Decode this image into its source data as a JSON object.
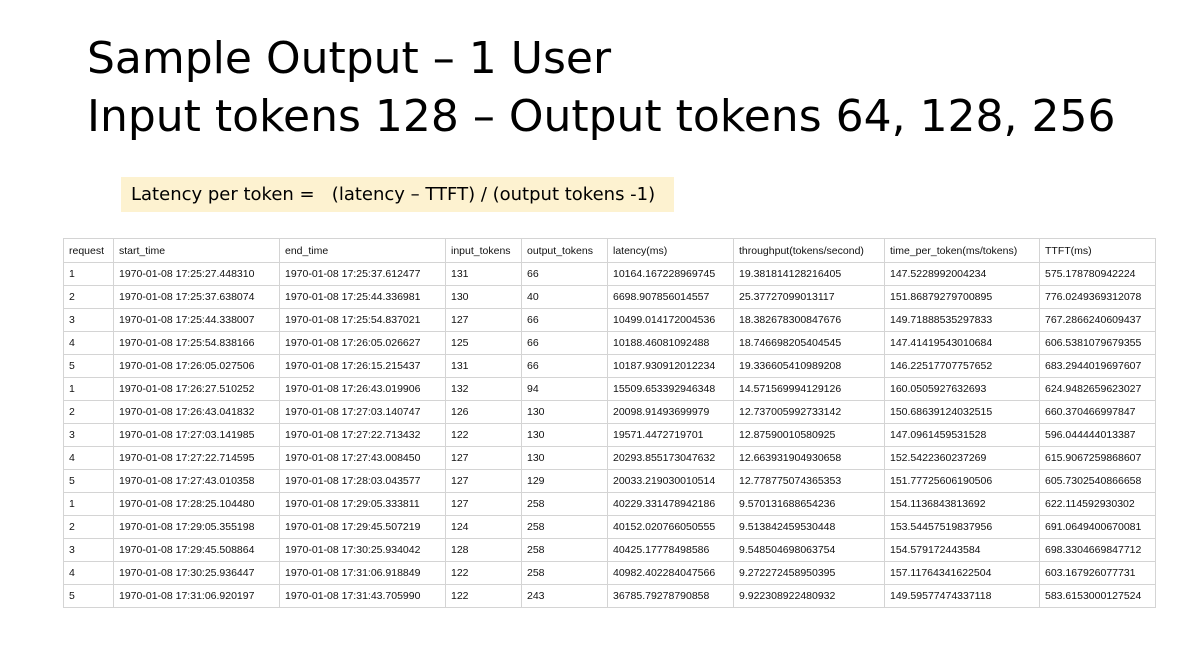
{
  "slide": {
    "title_line1": "Sample Output – 1 User",
    "title_line2": "Input tokens 128 – Output tokens 64, 128, 256",
    "formula": "Latency per token =   (latency – TTFT) / (output tokens -1)",
    "formula_bg": "#fdf2d0"
  },
  "table": {
    "headers": [
      "request",
      "start_time",
      "end_time",
      "input_tokens",
      "output_tokens",
      "latency(ms)",
      "throughput(tokens/second)",
      "time_per_token(ms/tokens)",
      "TTFT(ms)"
    ],
    "rows": [
      [
        "1",
        "1970-01-08 17:25:27.448310",
        "1970-01-08 17:25:37.612477",
        "131",
        "66",
        "10164.167228969745",
        "19.381814128216405",
        "147.5228992004234",
        "575.178780942224"
      ],
      [
        "2",
        "1970-01-08 17:25:37.638074",
        "1970-01-08 17:25:44.336981",
        "130",
        "40",
        "6698.907856014557",
        "25.37727099013117",
        "151.86879279700895",
        "776.0249369312078"
      ],
      [
        "3",
        "1970-01-08 17:25:44.338007",
        "1970-01-08 17:25:54.837021",
        "127",
        "66",
        "10499.014172004536",
        "18.382678300847676",
        "149.71888535297833",
        "767.2866240609437"
      ],
      [
        "4",
        "1970-01-08 17:25:54.838166",
        "1970-01-08 17:26:05.026627",
        "125",
        "66",
        "10188.46081092488",
        "18.746698205404545",
        "147.41419543010684",
        "606.5381079679355"
      ],
      [
        "5",
        "1970-01-08 17:26:05.027506",
        "1970-01-08 17:26:15.215437",
        "131",
        "66",
        "10187.930912012234",
        "19.336605410989208",
        "146.22517707757652",
        "683.2944019697607"
      ],
      [
        "1",
        "1970-01-08 17:26:27.510252",
        "1970-01-08 17:26:43.019906",
        "132",
        "94",
        "15509.653392946348",
        "14.571569994129126",
        "160.0505927632693",
        "624.9482659623027"
      ],
      [
        "2",
        "1970-01-08 17:26:43.041832",
        "1970-01-08 17:27:03.140747",
        "126",
        "130",
        "20098.91493699979",
        "12.737005992733142",
        "150.68639124032515",
        "660.370466997847"
      ],
      [
        "3",
        "1970-01-08 17:27:03.141985",
        "1970-01-08 17:27:22.713432",
        "122",
        "130",
        "19571.4472719701",
        "12.87590010580925",
        "147.0961459531528",
        "596.044444013387"
      ],
      [
        "4",
        "1970-01-08 17:27:22.714595",
        "1970-01-08 17:27:43.008450",
        "127",
        "130",
        "20293.855173047632",
        "12.663931904930658",
        "152.5422360237269",
        "615.9067259868607"
      ],
      [
        "5",
        "1970-01-08 17:27:43.010358",
        "1970-01-08 17:28:03.043577",
        "127",
        "129",
        "20033.219030010514",
        "12.778775074365353",
        "151.77725606190506",
        "605.7302540866658"
      ],
      [
        "1",
        "1970-01-08 17:28:25.104480",
        "1970-01-08 17:29:05.333811",
        "127",
        "258",
        "40229.331478942186",
        "9.570131688654236",
        "154.1136843813692",
        "622.114592930302"
      ],
      [
        "2",
        "1970-01-08 17:29:05.355198",
        "1970-01-08 17:29:45.507219",
        "124",
        "258",
        "40152.020766050555",
        "9.513842459530448",
        "153.54457519837956",
        "691.0649400670081"
      ],
      [
        "3",
        "1970-01-08 17:29:45.508864",
        "1970-01-08 17:30:25.934042",
        "128",
        "258",
        "40425.17778498586",
        "9.548504698063754",
        "154.579172443584",
        "698.3304669847712"
      ],
      [
        "4",
        "1970-01-08 17:30:25.936447",
        "1970-01-08 17:31:06.918849",
        "122",
        "258",
        "40982.402284047566",
        "9.272272458950395",
        "157.11764341622504",
        "603.167926077731"
      ],
      [
        "5",
        "1970-01-08 17:31:06.920197",
        "1970-01-08 17:31:43.705990",
        "122",
        "243",
        "36785.79278790858",
        "9.922308922480932",
        "149.59577474337118",
        "583.6153000127524"
      ]
    ]
  }
}
